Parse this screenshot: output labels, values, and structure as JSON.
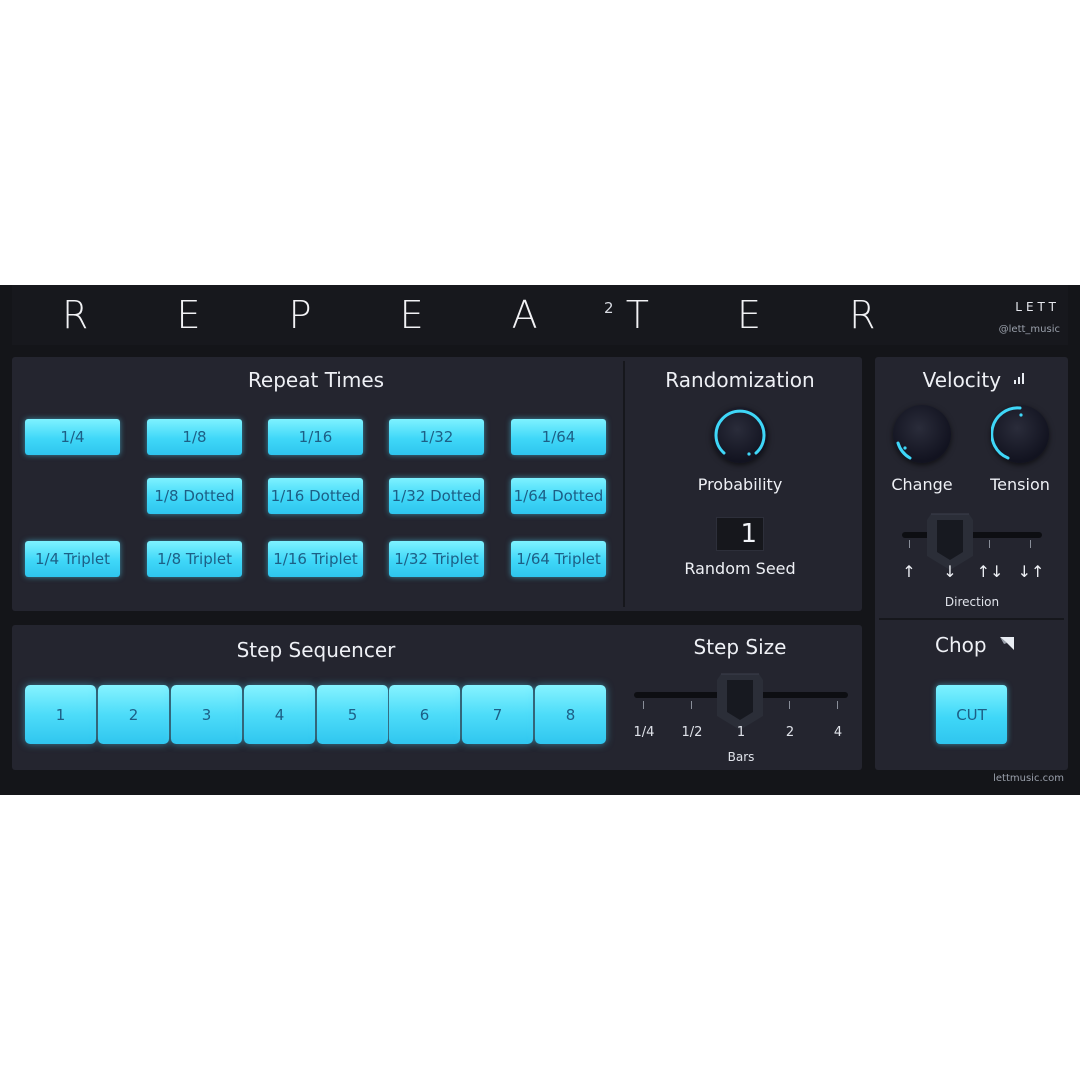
{
  "header": {
    "logo_text": "R E P E A T E R",
    "logo_sup": "2",
    "brand": "LETT",
    "handle": "@lett_music"
  },
  "repeat_times": {
    "title": "Repeat Times",
    "row1": [
      "1/4",
      "1/8",
      "1/16",
      "1/32",
      "1/64"
    ],
    "row2": [
      "1/8 Dotted",
      "1/16 Dotted",
      "1/32 Dotted",
      "1/64 Dotted"
    ],
    "row3": [
      "1/4 Triplet",
      "1/8 Triplet",
      "1/16 Triplet",
      "1/32 Triplet",
      "1/64 Triplet"
    ]
  },
  "randomization": {
    "title": "Randomization",
    "probability_label": "Probability",
    "seed_value": "1",
    "seed_label": "Random Seed"
  },
  "velocity": {
    "title": "Velocity",
    "change_label": "Change",
    "tension_label": "Tension",
    "direction_options": [
      "↑",
      "↓",
      "↑↓",
      "↓↑"
    ],
    "direction_label": "Direction"
  },
  "step_sequencer": {
    "title": "Step Sequencer",
    "steps": [
      "1",
      "2",
      "3",
      "4",
      "5",
      "6",
      "7",
      "8"
    ]
  },
  "step_size": {
    "title": "Step Size",
    "ticks": [
      "1/4",
      "1/2",
      "1",
      "2",
      "4"
    ],
    "unit_label": "Bars"
  },
  "chop": {
    "title": "Chop",
    "cut_label": "CUT"
  },
  "footer": {
    "website": "lettmusic.com"
  },
  "colors": {
    "accent": "#3fd7f8",
    "panel": "#24252f",
    "background": "#141519"
  }
}
